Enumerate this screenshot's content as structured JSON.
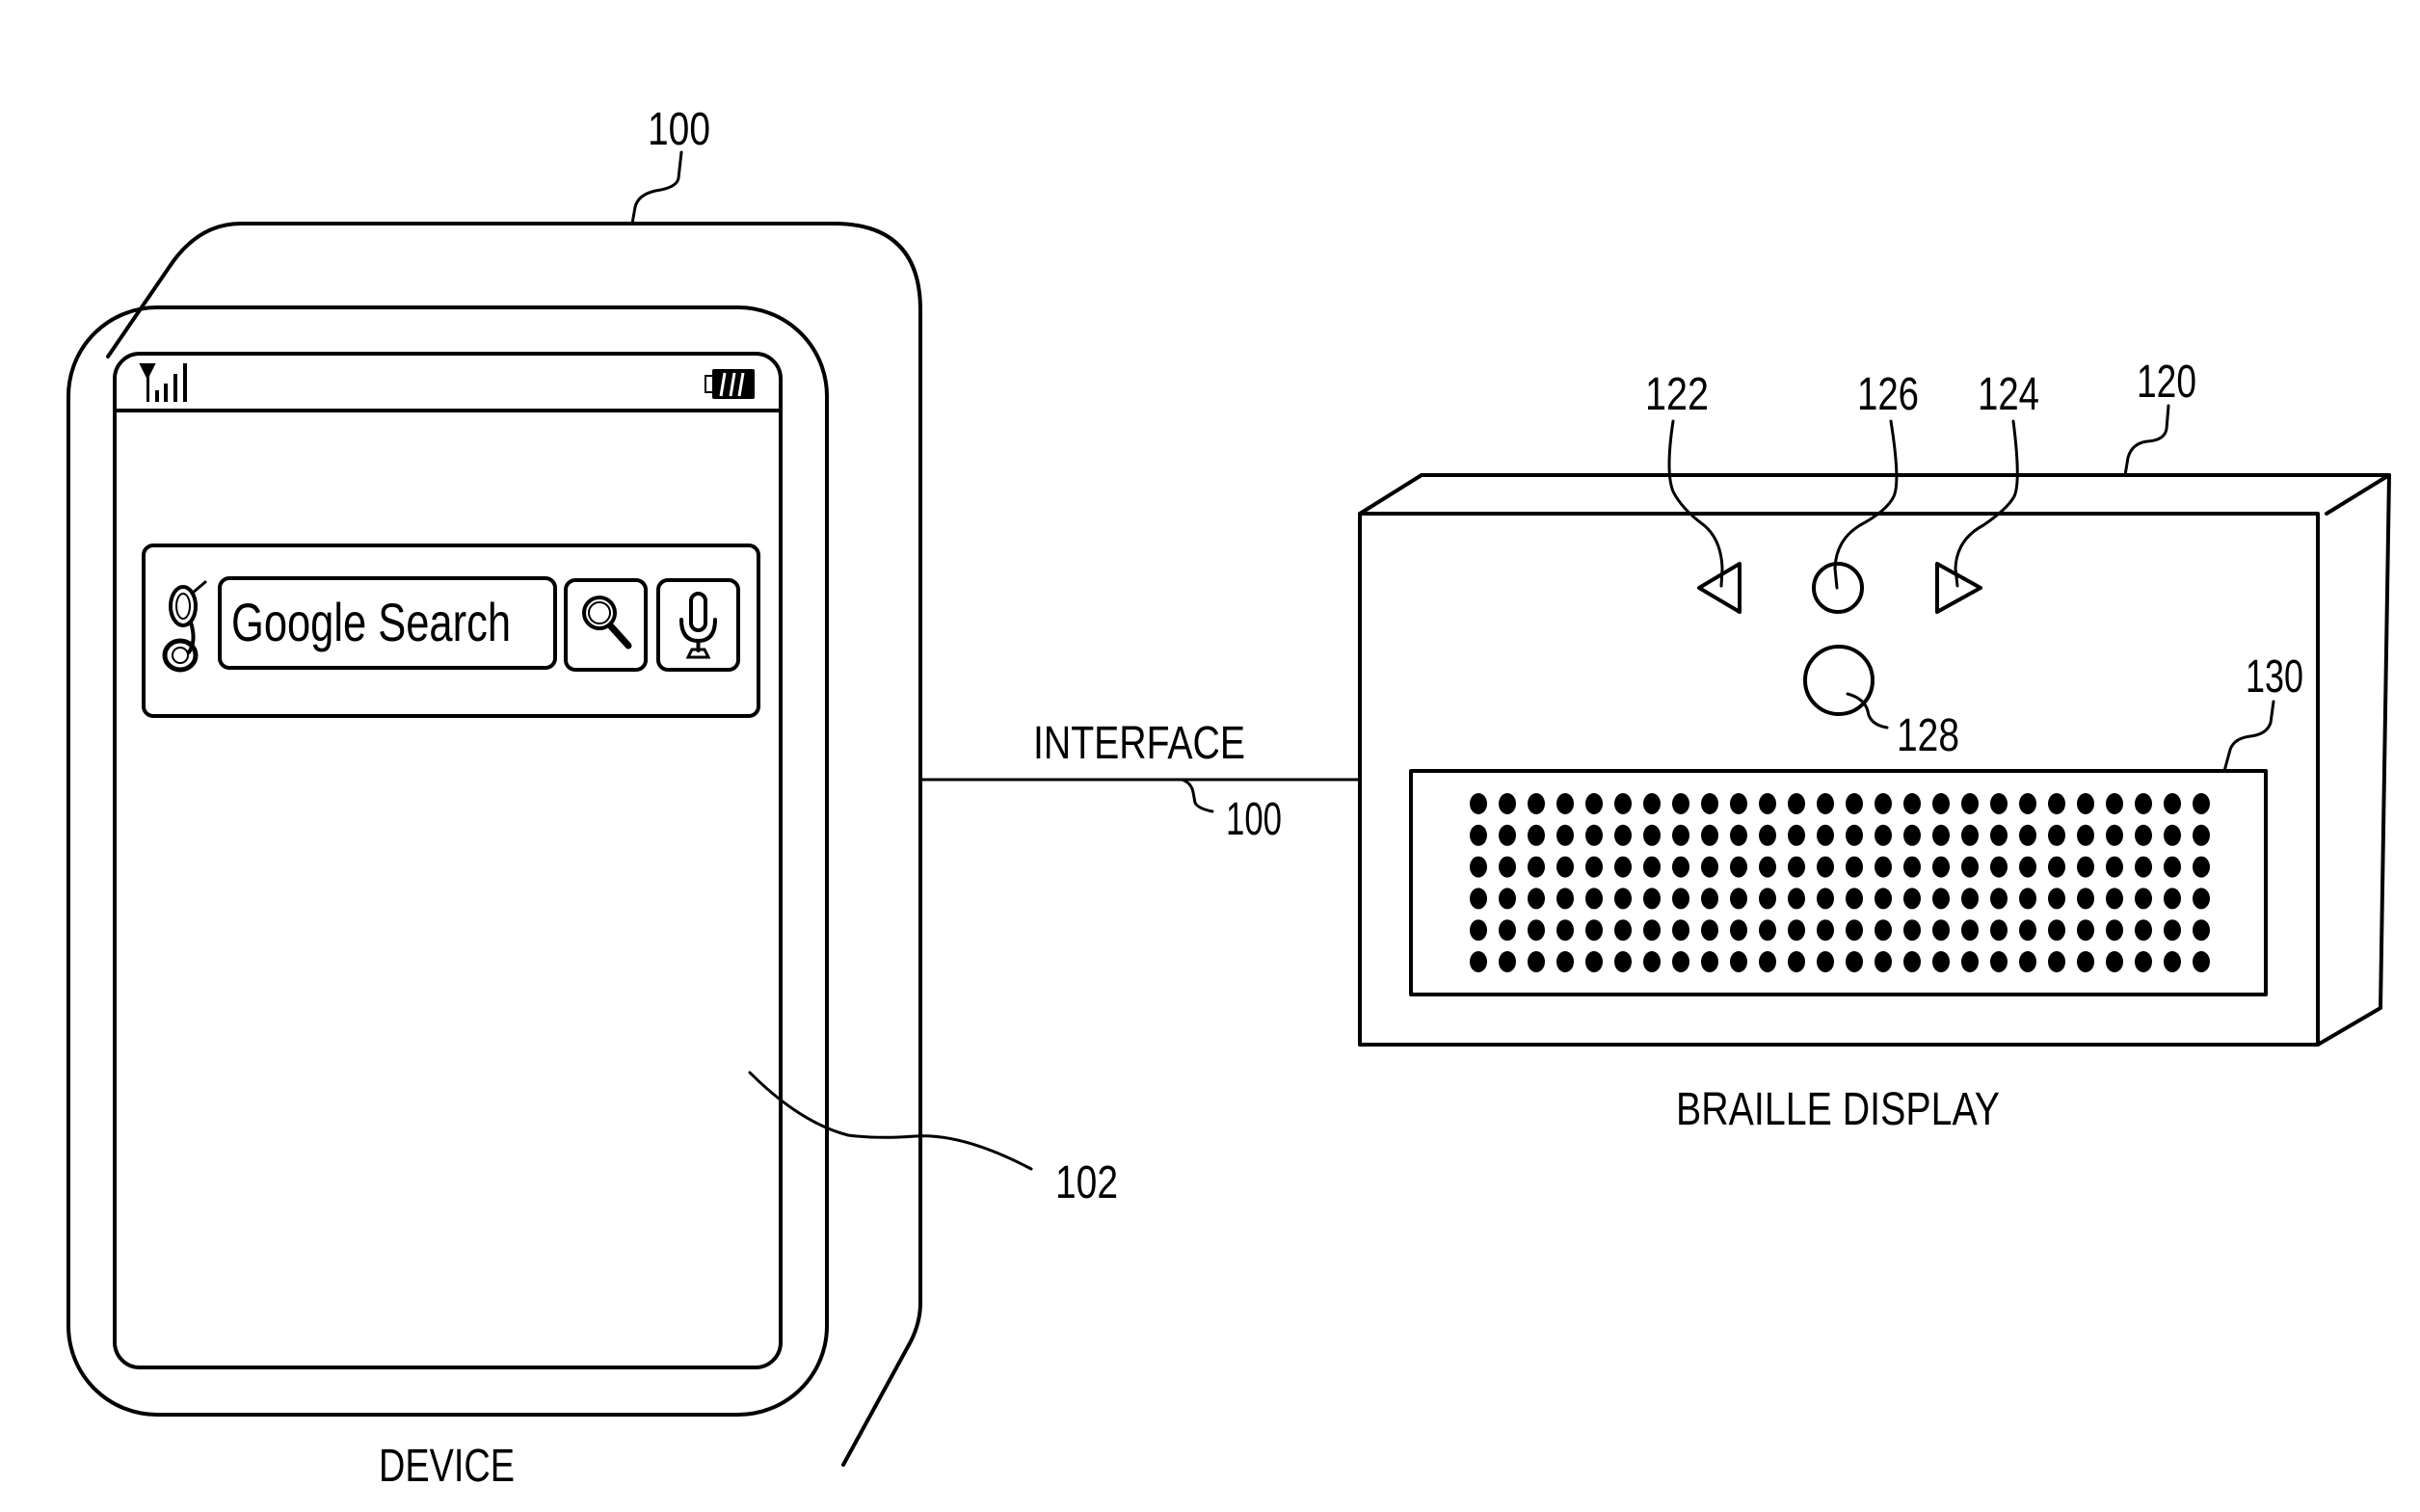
{
  "figure": {
    "device": {
      "caption": "DEVICE",
      "ref_device": "100",
      "ref_screen": "102",
      "status_bar": {
        "signal_icon": "signal-strength-icon",
        "battery_icon": "battery-icon"
      },
      "search_widget": {
        "logo_icon": "google-g-logo-icon",
        "field_text": "Google Search",
        "search_button_icon": "magnifier-icon",
        "voice_button_icon": "microphone-icon"
      }
    },
    "interface": {
      "label": "INTERFACE",
      "ref": "100"
    },
    "braille_display": {
      "caption": "BRAILLE DISPLAY",
      "ref_unit": "120",
      "ref_left_button": "122",
      "ref_right_button": "124",
      "ref_center_button": "126",
      "ref_round_button": "128",
      "ref_braille_cells": "130",
      "left_button_icon": "left-triangle-icon",
      "right_button_icon": "right-triangle-icon",
      "braille_grid": {
        "rows": 6,
        "columns": 26
      }
    }
  }
}
